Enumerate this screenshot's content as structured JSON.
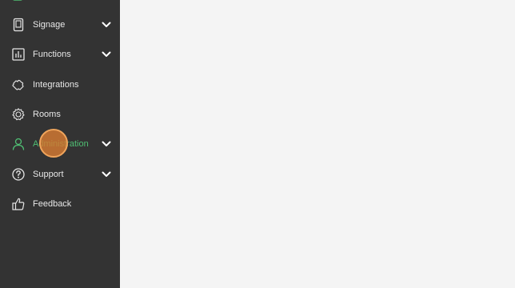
{
  "sidebar": {
    "items": [
      {
        "label": "Signage",
        "icon": "tablet-icon",
        "expandable": true
      },
      {
        "label": "Functions",
        "icon": "bar-chart-icon",
        "expandable": true
      },
      {
        "label": "Integrations",
        "icon": "puzzle-icon",
        "expandable": false
      },
      {
        "label": "Rooms",
        "icon": "gear-icon",
        "expandable": false
      },
      {
        "label": "Administration",
        "icon": "user-icon",
        "expandable": true,
        "active": true
      },
      {
        "label": "Support",
        "icon": "help-circle-icon",
        "expandable": true
      },
      {
        "label": "Feedback",
        "icon": "thumbs-up-icon",
        "expandable": false
      }
    ]
  },
  "colors": {
    "sidebar_bg": "#333333",
    "main_bg": "#f4f4f4",
    "active_text": "#4fbf73",
    "cursor_highlight": "#d67a32"
  }
}
